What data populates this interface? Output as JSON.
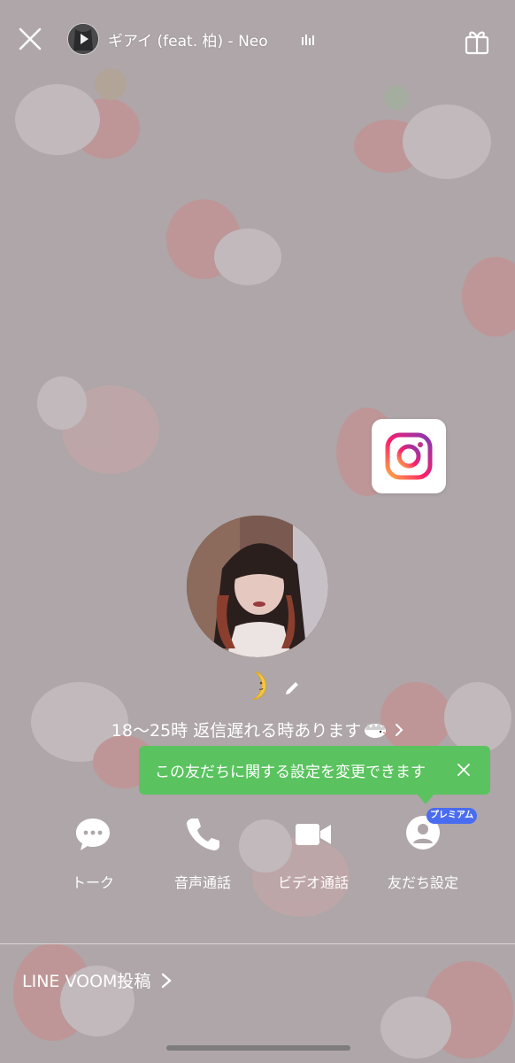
{
  "app": "LINE",
  "music": {
    "title": "ギアイ (feat. 柏) - Neo"
  },
  "profile": {
    "status_emoji": "🌛",
    "status_message": "18〜25時 返信遅れる時あります",
    "status_trailing_icon": "hedgehog-icon"
  },
  "tooltip": {
    "text": "この友だちに関する設定を変更できます"
  },
  "actions": [
    {
      "label": "トーク",
      "icon": "chat-bubble-icon"
    },
    {
      "label": "音声通話",
      "icon": "phone-icon"
    },
    {
      "label": "ビデオ通話",
      "icon": "video-camera-icon"
    },
    {
      "label": "友だち設定",
      "icon": "person-icon"
    }
  ],
  "premium_badge": "プレミアム",
  "voom": {
    "label": "LINE VOOM投稿"
  },
  "colors": {
    "background": "#aea6a8",
    "tooltip_green": "#5ac35f",
    "premium_blue": "#4a6cf0",
    "text": "#ffffff"
  }
}
